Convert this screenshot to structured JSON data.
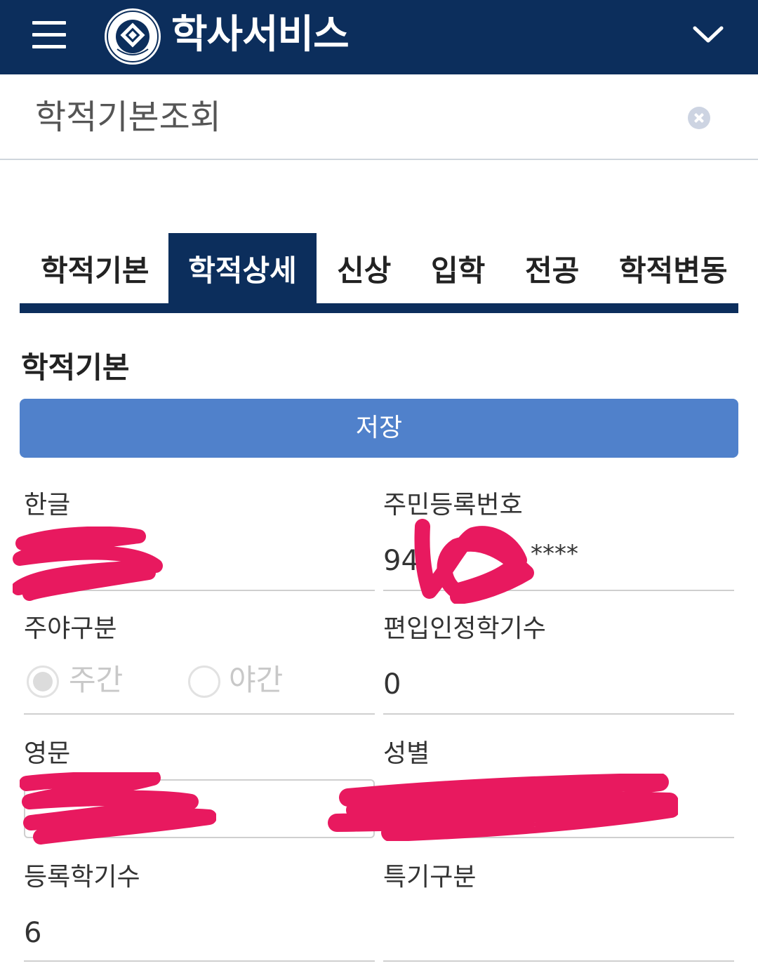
{
  "header": {
    "app_title": "학사서비스",
    "menu_icon": "hamburger-menu-icon",
    "logo": "ajou-university-seal",
    "expand_icon": "chevron-down-icon",
    "color": "#0c2e5c"
  },
  "page": {
    "title": "학적기본조회",
    "close_icon": "close-circle-icon"
  },
  "tabs": [
    {
      "label": "학적기본",
      "active": false
    },
    {
      "label": "학적상세",
      "active": true
    },
    {
      "label": "신상",
      "active": false
    },
    {
      "label": "입학",
      "active": false
    },
    {
      "label": "전공",
      "active": false
    },
    {
      "label": "학적변동",
      "active": false
    }
  ],
  "section": {
    "title": "학적기본",
    "save_label": "저장",
    "save_color": "#5081cb"
  },
  "fields": {
    "korean_name": {
      "label": "한글",
      "value": ""
    },
    "resident_number": {
      "label": "주민등록번호",
      "value_prefix": "94",
      "value_suffix": "****"
    },
    "day_night": {
      "label": "주야구분",
      "options": [
        "주간",
        "야간"
      ],
      "selected": "주간"
    },
    "transfer_terms": {
      "label": "편입인정학기수",
      "value": "0"
    },
    "english_name": {
      "label": "영문",
      "value": ""
    },
    "gender": {
      "label": "성별",
      "value": ""
    },
    "registered_terms": {
      "label": "등록학기수",
      "value": "6"
    },
    "special_category": {
      "label": "특기구분",
      "value": ""
    }
  },
  "redaction_color": "#e8195f"
}
